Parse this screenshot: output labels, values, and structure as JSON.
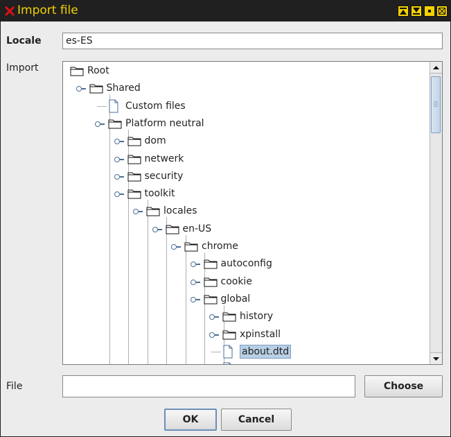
{
  "dialog": {
    "title": "Import file",
    "locale_label": "Locale",
    "locale_value": "es-ES",
    "import_label": "Import",
    "file_label": "File",
    "file_value": "",
    "choose_label": "Choose",
    "ok_label": "OK",
    "cancel_label": "Cancel"
  },
  "tree": {
    "nodes": [
      {
        "label": "Root",
        "type": "folder",
        "depth": 0,
        "expanded": true
      },
      {
        "label": "Shared",
        "type": "folder",
        "depth": 1,
        "expanded": true
      },
      {
        "label": "Custom files",
        "type": "file",
        "depth": 2
      },
      {
        "label": "Platform neutral",
        "type": "folder",
        "depth": 2,
        "expanded": true
      },
      {
        "label": "dom",
        "type": "folder",
        "depth": 3,
        "expanded": false
      },
      {
        "label": "netwerk",
        "type": "folder",
        "depth": 3,
        "expanded": false
      },
      {
        "label": "security",
        "type": "folder",
        "depth": 3,
        "expanded": false
      },
      {
        "label": "toolkit",
        "type": "folder",
        "depth": 3,
        "expanded": true
      },
      {
        "label": "locales",
        "type": "folder",
        "depth": 4,
        "expanded": true
      },
      {
        "label": "en-US",
        "type": "folder",
        "depth": 5,
        "expanded": true
      },
      {
        "label": "chrome",
        "type": "folder",
        "depth": 6,
        "expanded": true
      },
      {
        "label": "autoconfig",
        "type": "folder",
        "depth": 7,
        "expanded": false
      },
      {
        "label": "cookie",
        "type": "folder",
        "depth": 7,
        "expanded": false
      },
      {
        "label": "global",
        "type": "folder",
        "depth": 7,
        "expanded": true
      },
      {
        "label": "history",
        "type": "folder",
        "depth": 8,
        "expanded": false
      },
      {
        "label": "xpinstall",
        "type": "folder",
        "depth": 8,
        "expanded": false
      },
      {
        "label": "about.dtd",
        "type": "file",
        "depth": 8,
        "selected": true
      }
    ]
  },
  "colors": {
    "title_text": "#f2d200",
    "titlebar_bg": "#202020",
    "close_x": "#e01010",
    "selection": "#b8cfe5"
  }
}
